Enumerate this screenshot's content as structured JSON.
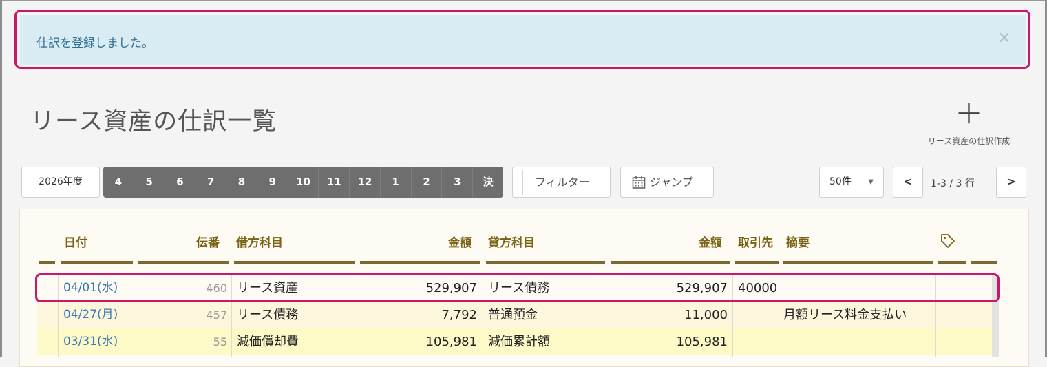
{
  "alert": {
    "message": "仕訳を登録しました。",
    "close_symbol": "×"
  },
  "page": {
    "title": "リース資産の仕訳一覧",
    "create_label": "リース資産の仕訳作成",
    "create_symbol": "+"
  },
  "toolbar": {
    "fiscal_year": "2026年度",
    "months": [
      "4",
      "5",
      "6",
      "7",
      "8",
      "9",
      "10",
      "11",
      "12",
      "1",
      "2",
      "3",
      "決"
    ],
    "filter_label": "フィルター",
    "jump_label": "ジャンプ",
    "per_page": "50件",
    "prev_symbol": "<",
    "next_symbol": ">",
    "page_info": "1-3 / 3 行"
  },
  "table": {
    "headers": {
      "date": "日付",
      "no": "伝番",
      "debit_account": "借方科目",
      "debit_amount": "金額",
      "credit_account": "貸方科目",
      "credit_amount": "金額",
      "partner": "取引先",
      "memo": "摘要"
    },
    "rows": [
      {
        "date": "04/01(水)",
        "no": "460",
        "debit_account": "リース資産",
        "debit_amount": "529,907",
        "credit_account": "リース債務",
        "credit_amount": "529,907",
        "partner": "40000",
        "memo": ""
      },
      {
        "date": "04/27(月)",
        "no": "457",
        "debit_account": "リース債務",
        "debit_amount": "7,792",
        "credit_account": "普通預金",
        "credit_amount": "11,000",
        "partner": "",
        "memo": "月額リース料金支払い"
      },
      {
        "date": "03/31(水)",
        "no": "55",
        "debit_account": "減価償却費",
        "debit_amount": "105,981",
        "credit_account": "減価累計額",
        "credit_amount": "105,981",
        "partner": "",
        "memo": ""
      }
    ]
  },
  "colors": {
    "highlight": "#c8186a",
    "alert_bg": "#d9ecf4",
    "header_text": "#7a6214",
    "row_alt_bg": "#fbf6dc",
    "row_yellow_bg": "#fdfac8"
  }
}
